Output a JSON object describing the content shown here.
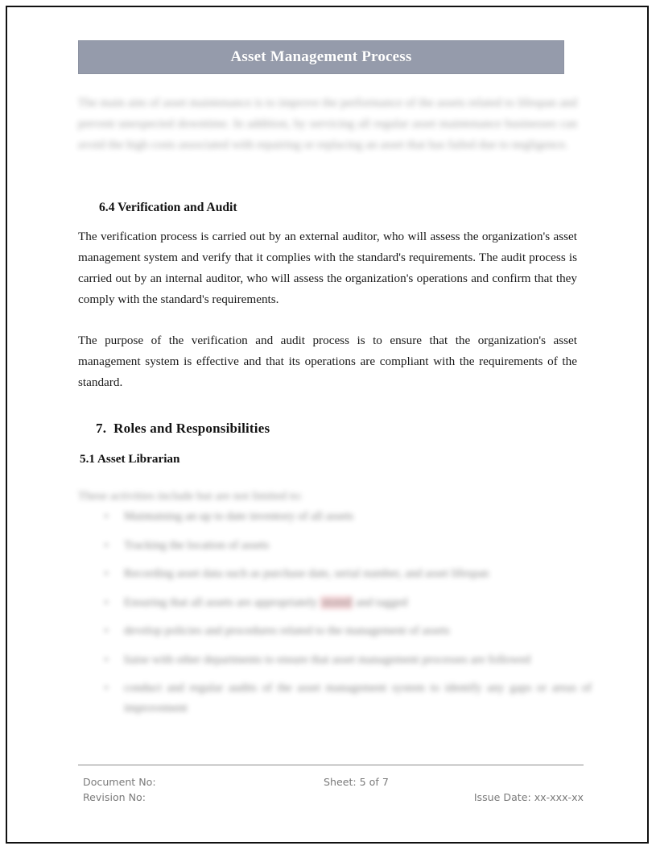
{
  "document": {
    "banner_title": "Asset Management Process",
    "intro_paragraph": "The main aim of asset maintenance is to improve the performance of the assets related to lifespan and prevent unexpected downtime. In addition, by servicing all regular asset maintenance businesses can avoid the high costs associated with repairing or replacing an asset that has failed due to negligence.",
    "sections": [
      {
        "heading": "6.4 Verification and Audit",
        "paragraphs": [
          "The verification process is carried out by an external auditor, who will assess the organization's asset management system and verify that it complies with the standard's requirements. The audit process is carried out by an internal auditor, who will assess the organization's operations and confirm that they comply with the standard's requirements.",
          "The purpose of the verification and audit process is to ensure that the organization's asset management system is effective and that its operations are compliant with the requirements of the standard."
        ]
      },
      {
        "number": "7.",
        "heading": "Roles and Responsibilities",
        "subheading": "5.1 Asset Librarian",
        "list_intro": "These activities include but are not limited to:",
        "bullets": [
          {
            "before": "Maintaining an up to date inventory of all assets",
            "highlight": "",
            "after": ""
          },
          {
            "before": "Tracking the location of assets",
            "highlight": "",
            "after": ""
          },
          {
            "before": "Recording asset data such as purchase date, serial number, and asset lifespan",
            "highlight": "",
            "after": ""
          },
          {
            "before": "Ensuring that all assets are appropriately ",
            "highlight": "stored",
            "after": " and tagged"
          },
          {
            "before": "develop policies and procedures related to the management of assets",
            "highlight": "",
            "after": ""
          },
          {
            "before": "liaise with other departments to ensure that asset management processes are followed",
            "highlight": "",
            "after": ""
          },
          {
            "before": "conduct and regular audits of the asset management system to identify any gaps or areas of improvement",
            "highlight": "",
            "after": ""
          }
        ]
      }
    ]
  },
  "footer": {
    "document_no_label": "Document No:",
    "revision_no_label": "Revision No:",
    "sheet_label": "Sheet: 5 of 7",
    "issue_date_label": "Issue Date: xx-xxx-xx"
  },
  "colors": {
    "banner_background": "#959bab",
    "banner_text": "#ffffff",
    "page_border": "#111111",
    "body_text": "#1a1a1a",
    "footer_text": "#7a7a7a",
    "highlight_red": "#e9a8ad"
  }
}
